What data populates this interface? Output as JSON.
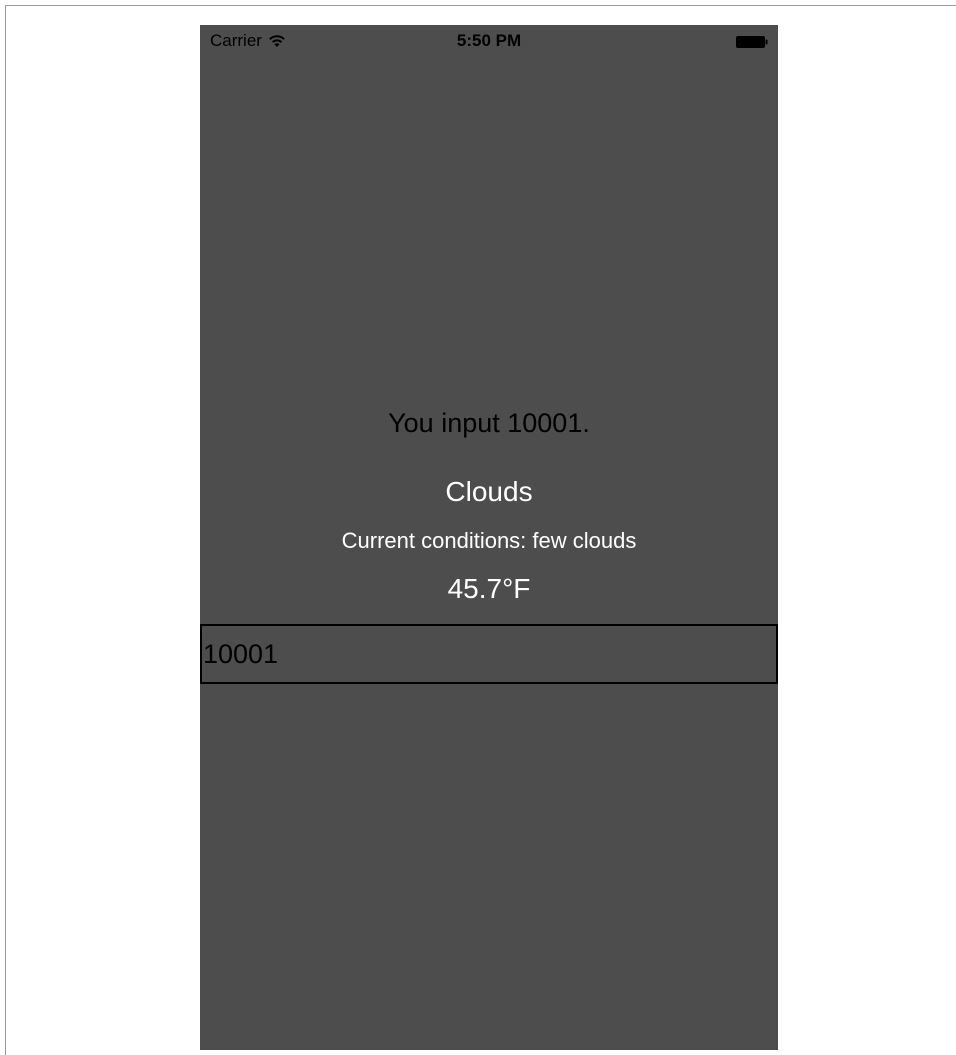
{
  "status_bar": {
    "carrier": "Carrier",
    "time": "5:50 PM"
  },
  "weather": {
    "input_echo": "You input 10001.",
    "condition_main": "Clouds",
    "condition_description": "Current conditions: few clouds",
    "temperature": "45.7°F"
  },
  "zip_input": {
    "value": "10001"
  },
  "colors": {
    "screen_background": "#4d4d4d",
    "primary_text": "#000000",
    "light_text": "#ffffff"
  },
  "icons": {
    "wifi": "wifi-icon",
    "battery": "battery-icon"
  }
}
